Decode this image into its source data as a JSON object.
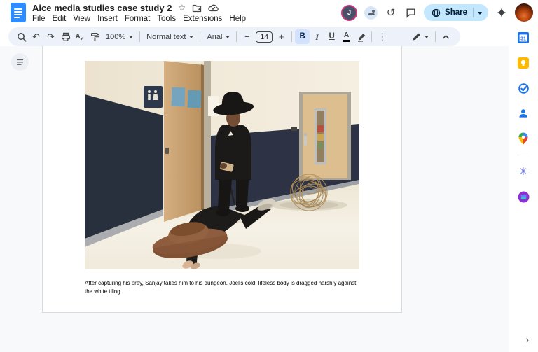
{
  "header": {
    "title": "Aice media studies case study 2",
    "menu": [
      "File",
      "Edit",
      "View",
      "Insert",
      "Format",
      "Tools",
      "Extensions",
      "Help"
    ],
    "collaborator_initial": "J",
    "share_label": "Share"
  },
  "toolbar": {
    "zoom": "100%",
    "paragraph_style": "Normal text",
    "font": "Arial",
    "font_size": "14",
    "bold": "B",
    "italic": "I",
    "underline": "U",
    "text_color": "A",
    "spellcheck_letter": "A",
    "spellcheck_check": "✓"
  },
  "icons": {
    "star": "☆",
    "undo": "↶",
    "redo": "↷",
    "history": "↺",
    "more_vertical": "⋮",
    "minus": "−",
    "plus": "+",
    "addon_flower": "✳",
    "side_panel_chevron": "›",
    "calendar_day": "31"
  },
  "document": {
    "caption": "After capturing his prey, Sanjay takes him to his dungeon. Joel's cold, lifeless body is dragged harshly against the white tiling."
  },
  "colors": {
    "toolbar_bg": "#edf2fa",
    "active_control_bg": "#d3e3fd",
    "share_bg": "#c2e7ff",
    "share_text": "#001d35",
    "canvas_bg": "#f8f9fa",
    "icon_gray": "#444746",
    "docs_blue": "#2d8cff",
    "google_blue": "#1a73e8",
    "keep_yellow": "#ffba00",
    "avatar_ring": "#c9377e",
    "navy_wall": "#222a3e"
  }
}
